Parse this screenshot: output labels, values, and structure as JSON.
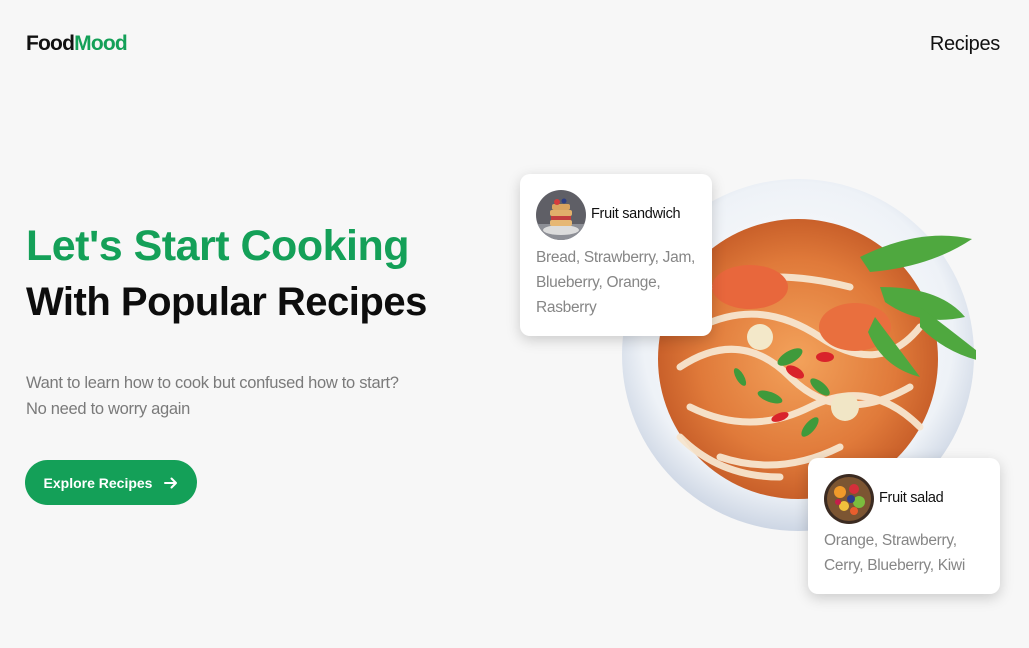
{
  "brand": {
    "part1": "Food",
    "part2": "Mood"
  },
  "nav": {
    "recipes_label": "Recipes"
  },
  "hero": {
    "title_line1": "Let's Start Cooking",
    "title_line2": "With Popular Recipes",
    "description_line1": "Want to learn how to cook but confused how to start?",
    "description_line2": "No need to worry again",
    "cta_label": "Explore Recipes"
  },
  "cards": [
    {
      "title": "Fruit sandwich",
      "ingredients": "Bread, Strawberry, Jam, Blueberry, Orange, Rasberry",
      "icon": "fruit-sandwich-photo"
    },
    {
      "title": "Fruit salad",
      "ingredients": "Orange, Strawberry, Cerry, Blueberry, Kiwi",
      "icon": "fruit-salad-photo"
    }
  ],
  "colors": {
    "accent": "#14a058",
    "background": "#f7f7f7",
    "text": "#111111",
    "muted": "#7a7a7a"
  }
}
